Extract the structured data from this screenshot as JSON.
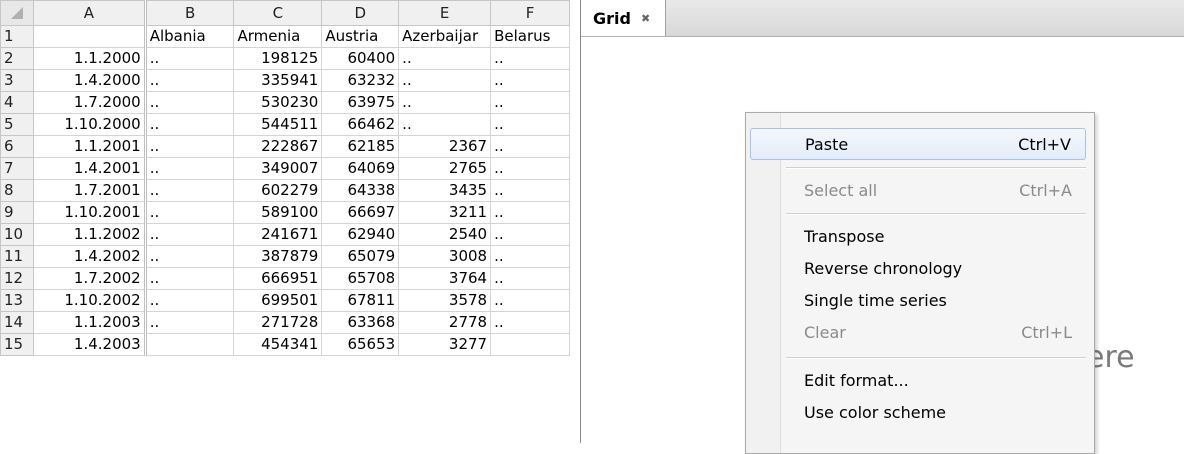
{
  "sheet": {
    "columns": [
      "A",
      "B",
      "C",
      "D",
      "E",
      "F"
    ],
    "header_row": {
      "num": "1",
      "cells": [
        "",
        "Albania",
        "Armenia",
        "Austria",
        "Azerbaijar",
        "Belarus"
      ]
    },
    "rows": [
      {
        "num": "2",
        "cells": [
          "1.1.2000",
          "..",
          "198125",
          "60400",
          "..",
          ".."
        ]
      },
      {
        "num": "3",
        "cells": [
          "1.4.2000",
          "..",
          "335941",
          "63232",
          "..",
          ".."
        ]
      },
      {
        "num": "4",
        "cells": [
          "1.7.2000",
          "..",
          "530230",
          "63975",
          "..",
          ".."
        ]
      },
      {
        "num": "5",
        "cells": [
          "1.10.2000",
          "..",
          "544511",
          "66462",
          "..",
          ".."
        ]
      },
      {
        "num": "6",
        "cells": [
          "1.1.2001",
          "..",
          "222867",
          "62185",
          "2367",
          ".."
        ]
      },
      {
        "num": "7",
        "cells": [
          "1.4.2001",
          "..",
          "349007",
          "64069",
          "2765",
          ".."
        ]
      },
      {
        "num": "8",
        "cells": [
          "1.7.2001",
          "..",
          "602279",
          "64338",
          "3435",
          ".."
        ]
      },
      {
        "num": "9",
        "cells": [
          "1.10.2001",
          "..",
          "589100",
          "66697",
          "3211",
          ".."
        ]
      },
      {
        "num": "10",
        "cells": [
          "1.1.2002",
          "..",
          "241671",
          "62940",
          "2540",
          ".."
        ]
      },
      {
        "num": "11",
        "cells": [
          "1.4.2002",
          "..",
          "387879",
          "65079",
          "3008",
          ".."
        ]
      },
      {
        "num": "12",
        "cells": [
          "1.7.2002",
          "..",
          "666951",
          "65708",
          "3764",
          ".."
        ]
      },
      {
        "num": "13",
        "cells": [
          "1.10.2002",
          "..",
          "699501",
          "67811",
          "3578",
          ".."
        ]
      },
      {
        "num": "14",
        "cells": [
          "1.1.2003",
          "..",
          "271728",
          "63368",
          "2778",
          ".."
        ]
      },
      {
        "num": "15",
        "cells": [
          "1.4.2003",
          "",
          "454341",
          "65653",
          "3277",
          ""
        ]
      }
    ]
  },
  "grid": {
    "tab_label": "Grid",
    "close_icon": "✖",
    "drop_hint": "ere"
  },
  "menu": {
    "items": [
      {
        "label": "Paste",
        "shortcut": "Ctrl+V",
        "enabled": true,
        "hover": true
      },
      {
        "label": "Select all",
        "shortcut": "Ctrl+A",
        "enabled": false
      },
      {
        "label": "Transpose",
        "shortcut": "",
        "enabled": true
      },
      {
        "label": "Reverse chronology",
        "shortcut": "",
        "enabled": true
      },
      {
        "label": "Single time series",
        "shortcut": "",
        "enabled": true
      },
      {
        "label": "Clear",
        "shortcut": "Ctrl+L",
        "enabled": false
      },
      {
        "label": "Edit format...",
        "shortcut": "",
        "enabled": true
      },
      {
        "label": "Use color scheme",
        "shortcut": "",
        "enabled": true
      }
    ]
  }
}
